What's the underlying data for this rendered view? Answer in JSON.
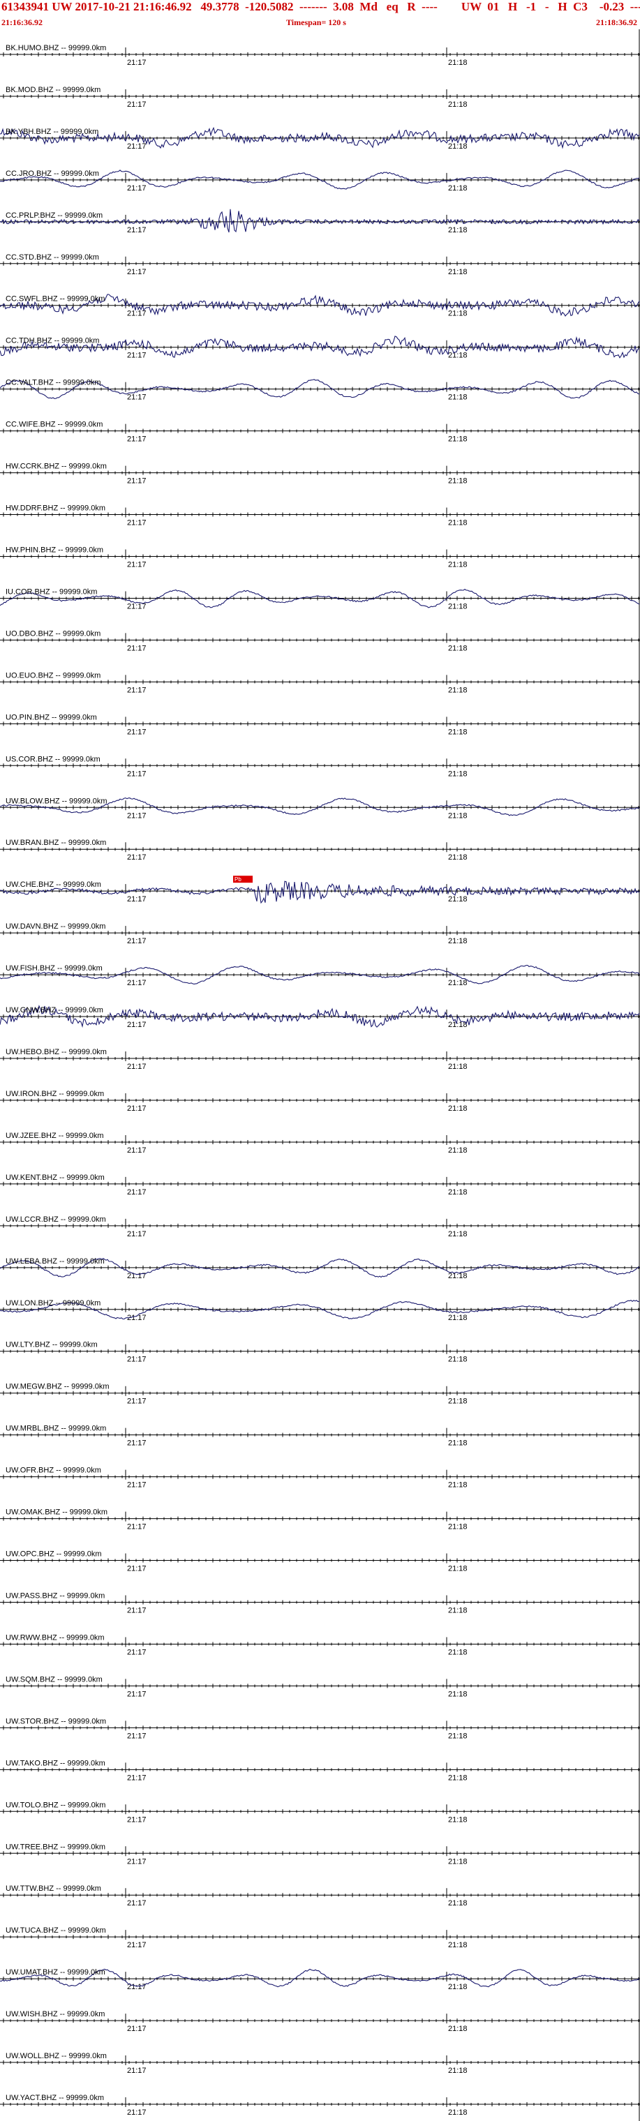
{
  "header": {
    "title": "61343941 UW 2017-10-21 21:16:46.92   49.3778  -120.5082  -------  3.08  Md   eq   R  ----        UW  01   H   -1   -   H  C3    -0.23  -----",
    "start_time": "21:16:36.92",
    "timespan": "Timespan= 120 s",
    "end_time": "21:18:36.92"
  },
  "colors": {
    "header_text": "#cc0000",
    "trace": "#1a1a6e",
    "pick_marker": "#dd0000",
    "baseline": "#000000"
  },
  "time_labels": [
    "21:17",
    "21:18"
  ],
  "pick": {
    "label": "Pb"
  },
  "channels": [
    {
      "label": "BK.HUMO.BHZ -- 99999.0km",
      "activity": "flat"
    },
    {
      "label": "BK.MOD.BHZ -- 99999.0km",
      "activity": "flat"
    },
    {
      "label": "BK.YBH.BHZ -- 99999.0km",
      "activity": "noisy"
    },
    {
      "label": "CC.JRO.BHZ -- 99999.0km",
      "activity": "wave"
    },
    {
      "label": "CC.PRLP.BHZ -- 99999.0km",
      "activity": "burst"
    },
    {
      "label": "CC.STD.BHZ -- 99999.0km",
      "activity": "flat"
    },
    {
      "label": "CC.SWFL.BHZ -- 99999.0km",
      "activity": "noisy"
    },
    {
      "label": "CC.TDH.BHZ -- 99999.0km",
      "activity": "noisy"
    },
    {
      "label": "CC.VALT.BHZ -- 99999.0km",
      "activity": "wave"
    },
    {
      "label": "CC.WIFE.BHZ -- 99999.0km",
      "activity": "flat"
    },
    {
      "label": "HW.CCRK.BHZ -- 99999.0km",
      "activity": "flat"
    },
    {
      "label": "HW.DDRF.BHZ -- 99999.0km",
      "activity": "flat"
    },
    {
      "label": "HW.PHIN.BHZ -- 99999.0km",
      "activity": "flat"
    },
    {
      "label": "IU.COR.BHZ -- 99999.0km",
      "activity": "wave"
    },
    {
      "label": "UO.DBO.BHZ -- 99999.0km",
      "activity": "flat"
    },
    {
      "label": "UO.EUO.BHZ -- 99999.0km",
      "activity": "flat"
    },
    {
      "label": "UO.PIN.BHZ -- 99999.0km",
      "activity": "flat"
    },
    {
      "label": "US.COR.BHZ -- 99999.0km",
      "activity": "flat"
    },
    {
      "label": "UW.BLOW.BHZ -- 99999.0km",
      "activity": "wave"
    },
    {
      "label": "UW.BRAN.BHZ -- 99999.0km",
      "activity": "flat"
    },
    {
      "label": "UW.CHE.BHZ -- 99999.0km",
      "activity": "quake"
    },
    {
      "label": "UW.DAVN.BHZ -- 99999.0km",
      "activity": "flat"
    },
    {
      "label": "UW.FISH.BHZ -- 99999.0km",
      "activity": "wave"
    },
    {
      "label": "UW.GNW.BHZ -- 99999.0km",
      "activity": "noisy"
    },
    {
      "label": "UW.HEBO.BHZ -- 99999.0km",
      "activity": "flat"
    },
    {
      "label": "UW.IRON.BHZ -- 99999.0km",
      "activity": "flat"
    },
    {
      "label": "UW.JZEE.BHZ -- 99999.0km",
      "activity": "flat"
    },
    {
      "label": "UW.KENT.BHZ -- 99999.0km",
      "activity": "flat"
    },
    {
      "label": "UW.LCCR.BHZ -- 99999.0km",
      "activity": "flat"
    },
    {
      "label": "UW.LEBA.BHZ -- 99999.0km",
      "activity": "wave"
    },
    {
      "label": "UW.LON.BHZ -- 99999.0km",
      "activity": "wave"
    },
    {
      "label": "UW.LTY.BHZ -- 99999.0km",
      "activity": "flat"
    },
    {
      "label": "UW.MEGW.BHZ -- 99999.0km",
      "activity": "flat"
    },
    {
      "label": "UW.MRBL.BHZ -- 99999.0km",
      "activity": "flat"
    },
    {
      "label": "UW.OFR.BHZ -- 99999.0km",
      "activity": "flat"
    },
    {
      "label": "UW.OMAK.BHZ -- 99999.0km",
      "activity": "flat"
    },
    {
      "label": "UW.OPC.BHZ -- 99999.0km",
      "activity": "flat"
    },
    {
      "label": "UW.PASS.BHZ -- 99999.0km",
      "activity": "flat"
    },
    {
      "label": "UW.RWW.BHZ -- 99999.0km",
      "activity": "flat"
    },
    {
      "label": "UW.SQM.BHZ -- 99999.0km",
      "activity": "flat"
    },
    {
      "label": "UW.STOR.BHZ -- 99999.0km",
      "activity": "flat"
    },
    {
      "label": "UW.TAKO.BHZ -- 99999.0km",
      "activity": "flat"
    },
    {
      "label": "UW.TOLO.BHZ -- 99999.0km",
      "activity": "flat"
    },
    {
      "label": "UW.TREE.BHZ -- 99999.0km",
      "activity": "flat"
    },
    {
      "label": "UW.TTW.BHZ -- 99999.0km",
      "activity": "flat"
    },
    {
      "label": "UW.TUCA.BHZ -- 99999.0km",
      "activity": "flat"
    },
    {
      "label": "UW.UMAT.BHZ -- 99999.0km",
      "activity": "wave"
    },
    {
      "label": "UW.WISH.BHZ -- 99999.0km",
      "activity": "flat"
    },
    {
      "label": "UW.WOLL.BHZ -- 99999.0km",
      "activity": "flat"
    },
    {
      "label": "UW.YACT.BHZ -- 99999.0km",
      "activity": "flat"
    }
  ]
}
